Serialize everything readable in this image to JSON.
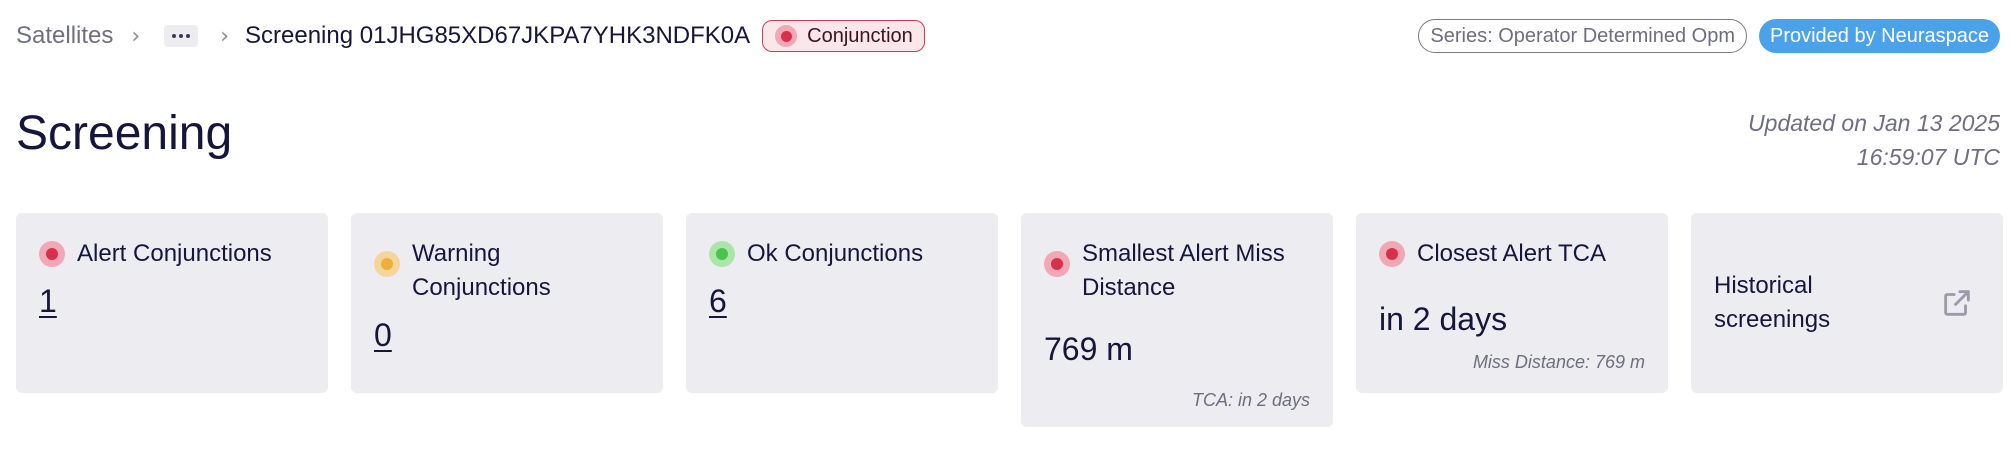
{
  "breadcrumb": {
    "root": "Satellites",
    "more_label": "…",
    "current": "Screening 01JHG85XD67JKPA7YHK3NDFK0A",
    "status_chip": "Conjunction",
    "separator": "›"
  },
  "header": {
    "series_pill": "Series: Operator Determined Opm",
    "provider_pill": "Provided by Neuraspace"
  },
  "page": {
    "title": "Screening",
    "updated_line1": "Updated on Jan 13 2025",
    "updated_line2": "16:59:07 UTC"
  },
  "cards": {
    "alert": {
      "label": "Alert Conjunctions",
      "value": "1",
      "status": "alert"
    },
    "warning": {
      "label": "Warning Conjunctions",
      "value": "0",
      "status": "warning"
    },
    "ok": {
      "label": "Ok Conjunctions",
      "value": "6",
      "status": "ok"
    },
    "smallest_miss": {
      "label": "Smallest Alert Miss Distance",
      "value": "769 m",
      "note": "TCA: in 2 days",
      "status": "alert"
    },
    "closest_tca": {
      "label": "Closest Alert TCA",
      "value": "in 2 days",
      "note": "Miss Distance: 769 m",
      "status": "alert"
    },
    "historical": {
      "label": "Historical screenings",
      "icon": "external-link-icon"
    }
  },
  "colors": {
    "alert": "#d6304d",
    "warning": "#efad3c",
    "ok": "#4cc44c",
    "provider_accent": "#4aa3ea",
    "card_background": "#ececf1"
  }
}
